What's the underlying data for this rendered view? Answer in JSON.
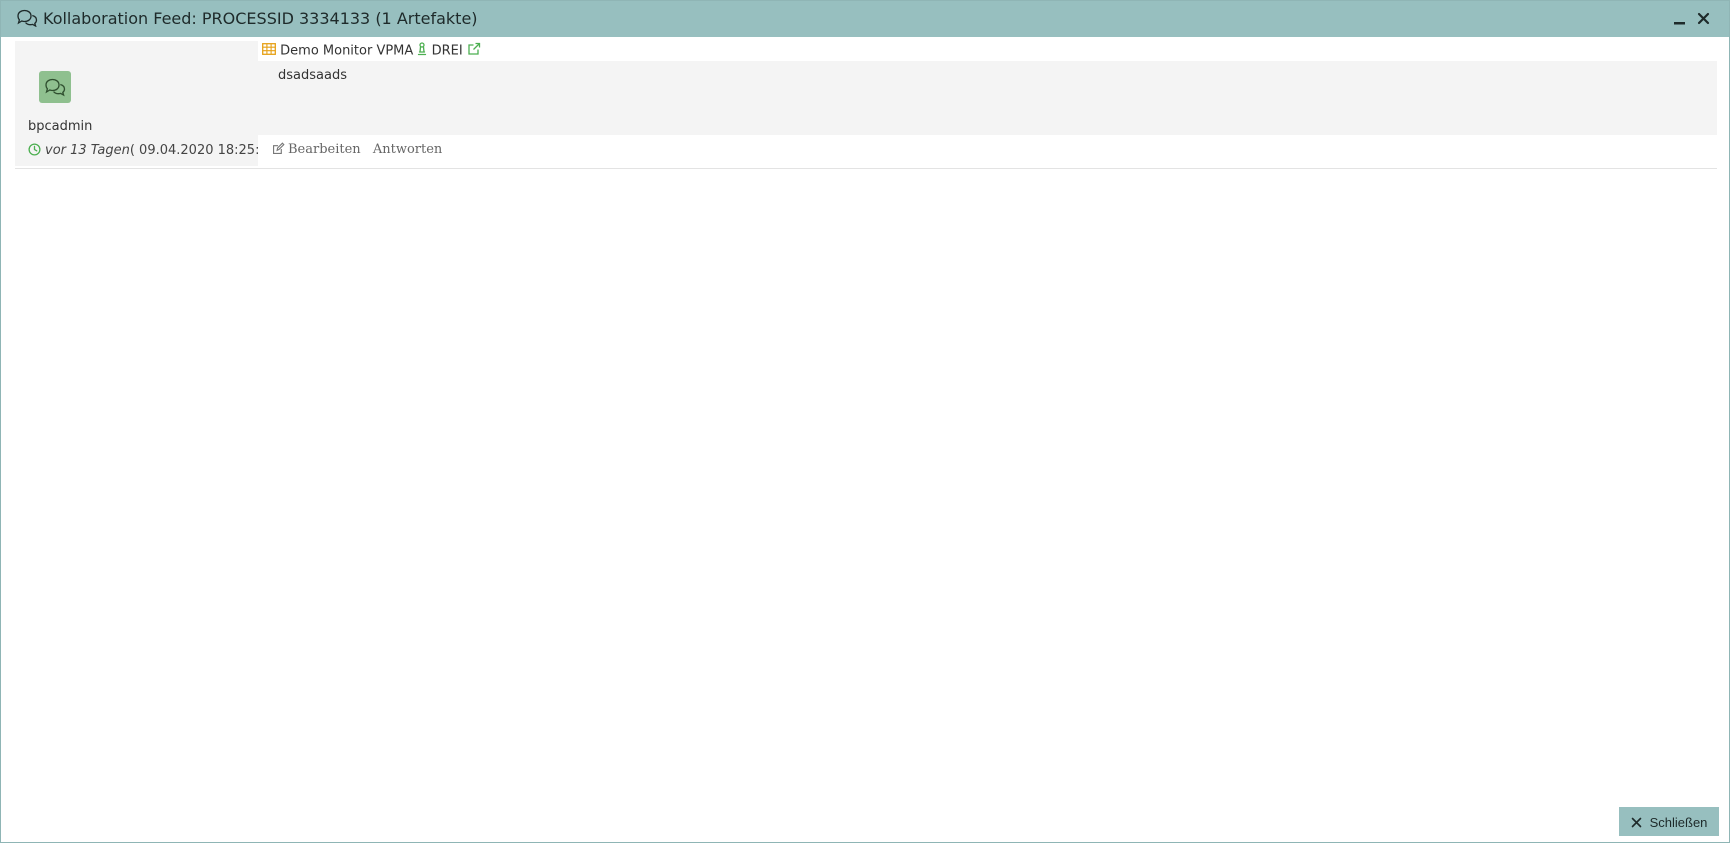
{
  "window": {
    "title": "Kollaboration Feed: PROCESSID 3334133 (1 Artefakte)"
  },
  "feed": {
    "items": [
      {
        "user": "bpcadmin",
        "time_relative": "vor 13 Tagen",
        "time_absolute": "( 09.04.2020 18:25:...",
        "artifact": {
          "name": "Demo Monitor VPMA",
          "context": "DREI"
        },
        "message": "dsadsaads",
        "actions": {
          "edit_label": "Bearbeiten",
          "reply_label": "Antworten"
        }
      }
    ]
  },
  "footer": {
    "close_label": "Schließen"
  },
  "colors": {
    "titlebar": "#97bfbf",
    "avatar": "#8fc08f",
    "accent_green": "#4caf50",
    "table_icon": "#e6a117"
  },
  "icons": {
    "title": "comments-icon",
    "avatar": "comments-icon",
    "time": "clock-icon",
    "artifact": "table-icon",
    "context": "chess-pawn-icon",
    "open": "external-link-icon",
    "edit": "edit-icon",
    "close": "close-icon"
  }
}
